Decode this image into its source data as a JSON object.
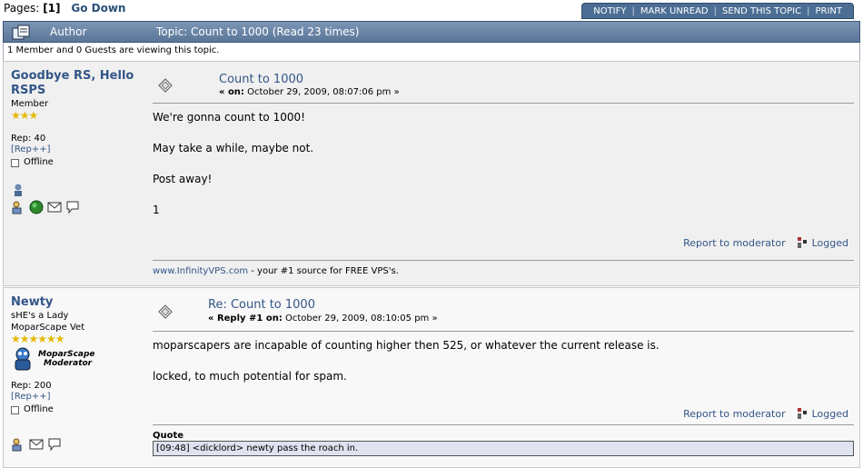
{
  "pages": {
    "label": "Pages:",
    "current": "[1]",
    "go_down": "Go Down"
  },
  "actions": {
    "notify": "NOTIFY",
    "mark_unread": "MARK UNREAD",
    "send": "SEND THIS TOPIC",
    "print": "PRINT"
  },
  "header": {
    "author": "Author",
    "topic": "Topic: Count to 1000  (Read 23 times)"
  },
  "viewing": "1 Member and 0 Guests are viewing this topic.",
  "post1": {
    "name": "Goodbye RS, Hello RSPS",
    "rank": "Member",
    "stars": "★★★",
    "rep": "Rep: 40",
    "rep_link": "[Rep++]",
    "status": "Offline",
    "subject": "Count to 1000",
    "on_label": "« on:",
    "date": "October 29, 2009, 08:07:06 pm »",
    "lines": [
      "We're gonna count to 1000!",
      "May take a while, maybe not.",
      "Post away!",
      "1"
    ],
    "report": "Report to moderator",
    "logged": "Logged",
    "sig_url": "www.InfinityVPS.com",
    "sig_text": " - your #1 source for FREE VPS's."
  },
  "post2": {
    "name": "Newty",
    "rank1": "sHE's a Lady",
    "rank2": "MoparScape Vet",
    "stars": "★★★★★★",
    "badge_line1": "MoparScape",
    "badge_line2": "Moderator",
    "rep": "Rep: 200",
    "rep_link": "[Rep++]",
    "status": "Offline",
    "subject": "Re: Count to 1000",
    "reply_label": "« Reply #1 on:",
    "date": "October 29, 2009, 08:10:05 pm »",
    "lines": [
      "moparscapers are incapable of counting higher then 525, or whatever the current release is.",
      "locked, to much potential for spam."
    ],
    "report": "Report to moderator",
    "logged": "Logged",
    "quote_label": "Quote",
    "quote_text": "[09:48] <dicklord> newty pass the roach in."
  },
  "colors": {
    "link": "#335588",
    "header_bg": "#5a7698",
    "post_bg": "#f0f0f0",
    "quote_bg": "#dfe2ef"
  }
}
